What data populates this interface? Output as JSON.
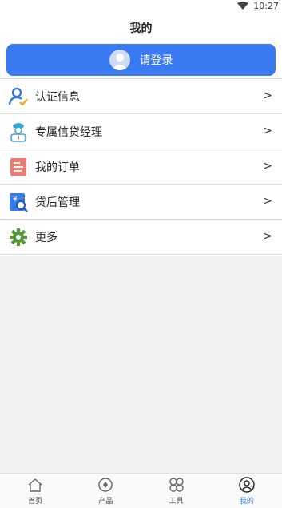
{
  "status_bar": {
    "time": "10:27",
    "icon": "wifi-icon"
  },
  "header": {
    "title": "我的"
  },
  "login": {
    "label": "请登录",
    "icon": "user-avatar-icon"
  },
  "menu": {
    "items": [
      {
        "label": "认证信息",
        "icon": "verify-icon",
        "chevron": ">"
      },
      {
        "label": "专属信贷经理",
        "icon": "manager-icon",
        "chevron": ">"
      },
      {
        "label": "我的订单",
        "icon": "order-icon",
        "chevron": ">"
      },
      {
        "label": "贷后管理",
        "icon": "loan-manage-icon",
        "chevron": ">"
      },
      {
        "label": "更多",
        "icon": "gear-icon",
        "chevron": ">"
      }
    ]
  },
  "bottom_nav": {
    "items": [
      {
        "label": "首页",
        "icon": "home-icon"
      },
      {
        "label": "产品",
        "icon": "product-icon"
      },
      {
        "label": "工具",
        "icon": "tools-icon"
      },
      {
        "label": "我的",
        "icon": "profile-icon",
        "active": true
      }
    ]
  },
  "colors": {
    "accent": "#3b7bf2",
    "background": "#f2f2f2"
  }
}
